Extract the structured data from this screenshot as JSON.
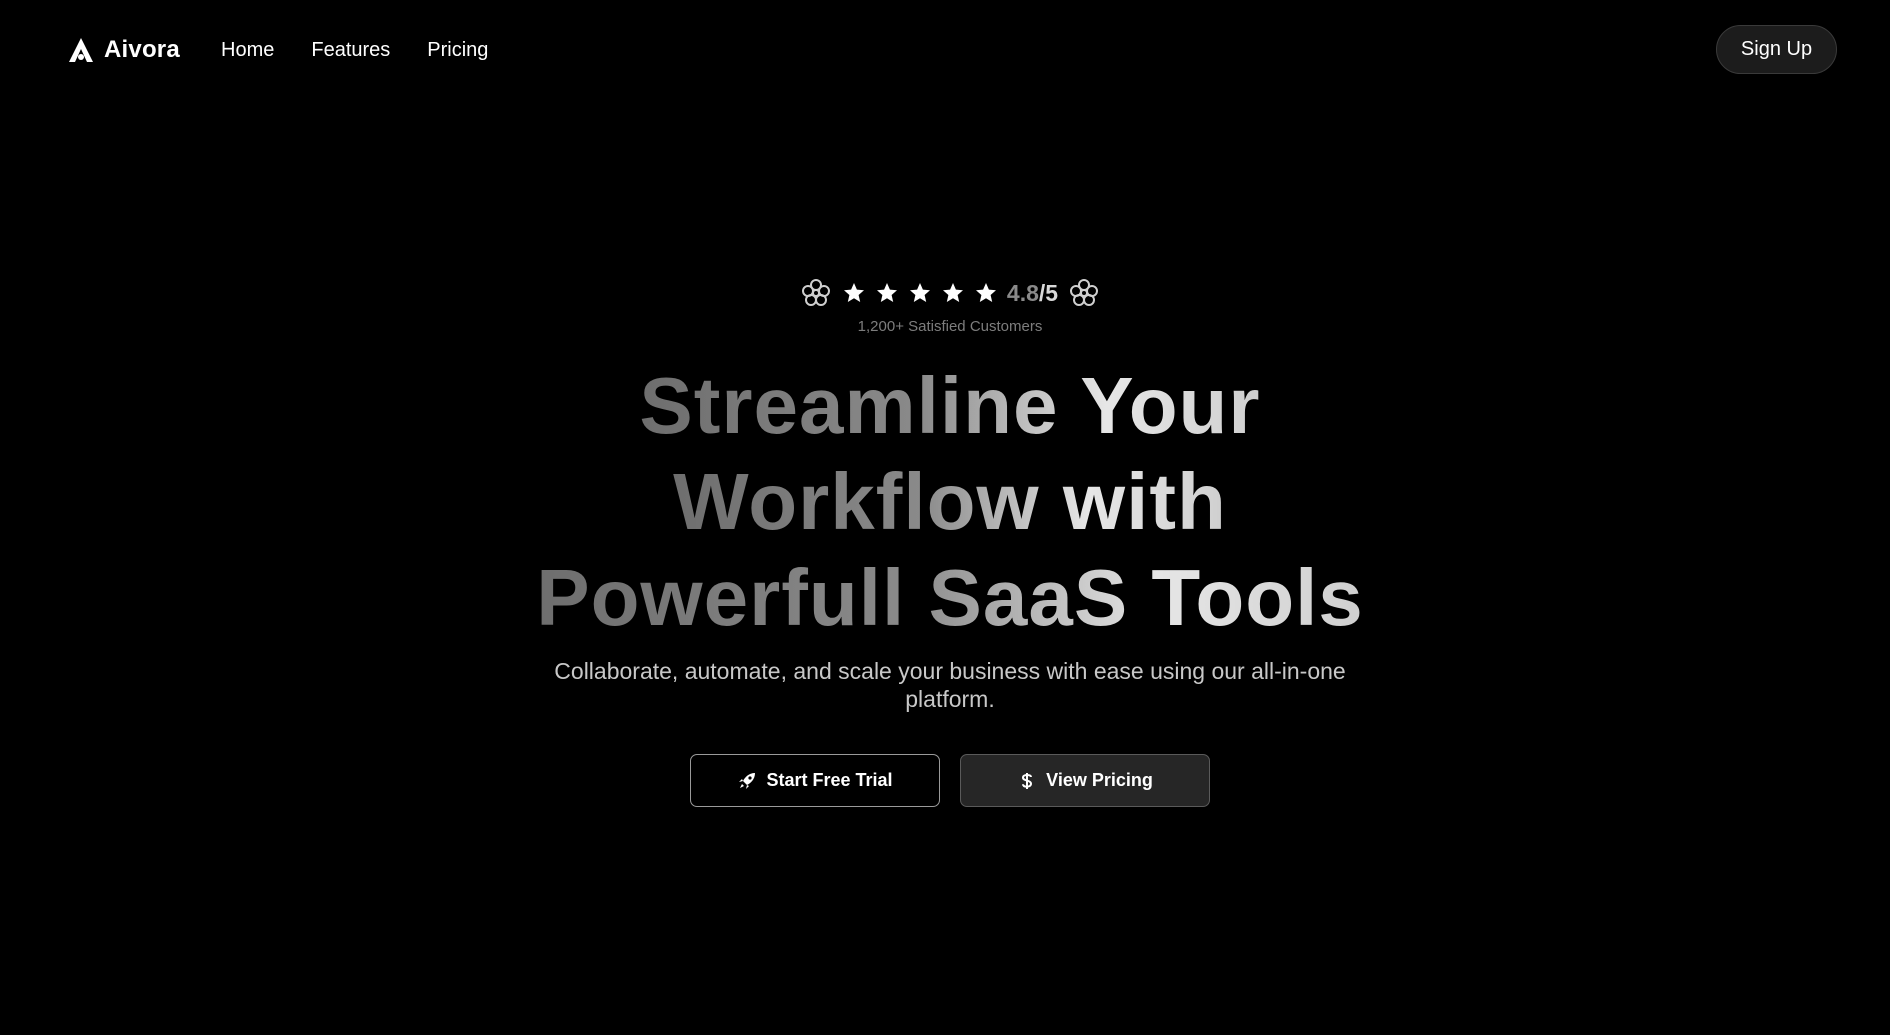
{
  "nav": {
    "brand": "Aivora",
    "brand_icon": "aivora-logo-icon",
    "links": [
      {
        "label": "Home"
      },
      {
        "label": "Features"
      },
      {
        "label": "Pricing"
      }
    ],
    "signup_label": "Sign Up"
  },
  "hero": {
    "rating": {
      "stars": 5,
      "value": "4.8",
      "denominator": "/5",
      "left_icon": "laurel-icon",
      "right_icon": "laurel-icon"
    },
    "customers_text": "1,200+ Satisfied Customers",
    "headline": {
      "line1": "Streamline Your",
      "line2": "Workflow with",
      "line3": "Powerfull SaaS Tools"
    },
    "subtitle": "Collaborate, automate, and scale your business with ease using our all-in-one platform.",
    "primary_cta": {
      "label": "Start Free Trial",
      "icon": "rocket-icon"
    },
    "secondary_cta": {
      "label": "View Pricing",
      "icon": "dollar-icon"
    }
  },
  "colors": {
    "background": "#000000",
    "text": "#ffffff",
    "muted": "#7d7d7d",
    "button_dark": "#262626",
    "signup_bg": "#1c1c1c"
  }
}
